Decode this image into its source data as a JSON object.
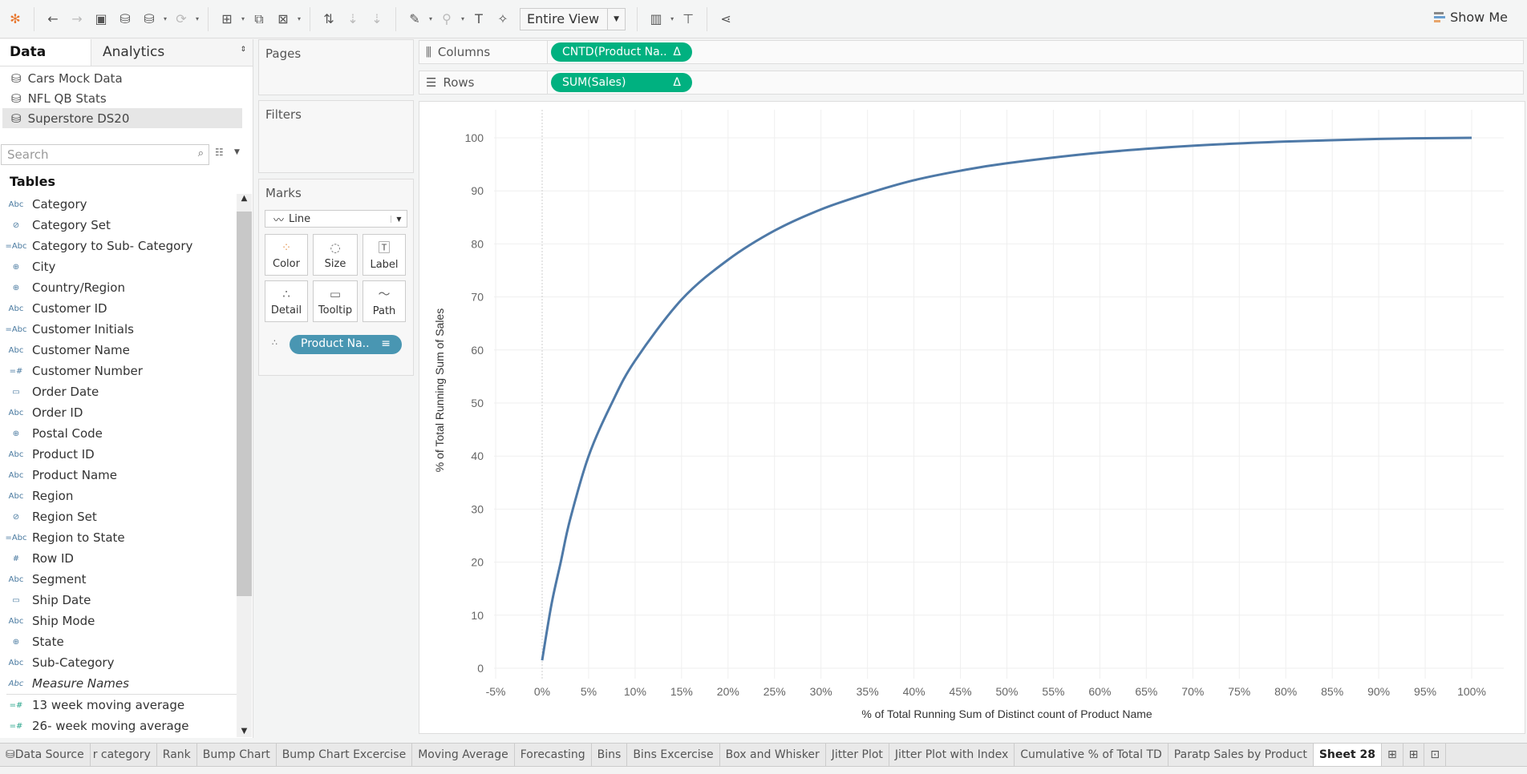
{
  "toolbar": {
    "fit": "Entire View",
    "show_me": "Show Me"
  },
  "left": {
    "tab_data": "Data",
    "tab_analytics": "Analytics",
    "datasources": [
      "Cars Mock Data",
      "NFL QB Stats",
      "Superstore DS20"
    ],
    "search_placeholder": "Search",
    "tables_heading": "Tables",
    "dims": [
      {
        "icon": "Abc",
        "label": "Category"
      },
      {
        "icon": "set",
        "label": "Category Set"
      },
      {
        "icon": "=Abc",
        "label": "Category to Sub- Category"
      },
      {
        "icon": "globe",
        "label": "City"
      },
      {
        "icon": "globe",
        "label": "Country/Region"
      },
      {
        "icon": "Abc",
        "label": "Customer ID"
      },
      {
        "icon": "=Abc",
        "label": "Customer Initials"
      },
      {
        "icon": "Abc",
        "label": "Customer Name"
      },
      {
        "icon": "=#",
        "label": "Customer Number"
      },
      {
        "icon": "date",
        "label": "Order Date"
      },
      {
        "icon": "Abc",
        "label": "Order ID"
      },
      {
        "icon": "globe",
        "label": "Postal Code"
      },
      {
        "icon": "Abc",
        "label": "Product ID"
      },
      {
        "icon": "Abc",
        "label": "Product Name"
      },
      {
        "icon": "Abc",
        "label": "Region"
      },
      {
        "icon": "set",
        "label": "Region Set"
      },
      {
        "icon": "=Abc",
        "label": "Region to State"
      },
      {
        "icon": "#",
        "label": "Row ID"
      },
      {
        "icon": "Abc",
        "label": "Segment"
      },
      {
        "icon": "date",
        "label": "Ship Date"
      },
      {
        "icon": "Abc",
        "label": "Ship Mode"
      },
      {
        "icon": "globe",
        "label": "State"
      },
      {
        "icon": "Abc",
        "label": "Sub-Category"
      },
      {
        "icon": "Abc",
        "label": "Measure Names"
      }
    ],
    "measures": [
      {
        "icon": "=#",
        "label": "13 week moving average"
      },
      {
        "icon": "=#",
        "label": "26- week moving average"
      }
    ]
  },
  "cards": {
    "pages": "Pages",
    "filters": "Filters",
    "marks": "Marks",
    "mark_type": "Line",
    "buttons": [
      "Color",
      "Size",
      "Label",
      "Detail",
      "Tooltip",
      "Path"
    ],
    "detail_pill": "Product Na.."
  },
  "shelves": {
    "columns_label": "Columns",
    "columns_pill": "CNTD(Product Na..",
    "rows_label": "Rows",
    "rows_pill": "SUM(Sales)",
    "delta": "Δ"
  },
  "chart_data": {
    "type": "line",
    "xlabel": "% of Total Running Sum of Distinct count of Product Name",
    "ylabel": "% of Total Running Sum of Sales",
    "xlim": [
      -5,
      100
    ],
    "ylim": [
      0,
      100
    ],
    "x_ticks": [
      -5,
      0,
      5,
      10,
      15,
      20,
      25,
      30,
      35,
      40,
      45,
      50,
      55,
      60,
      65,
      70,
      75,
      80,
      85,
      90,
      95,
      100
    ],
    "y_ticks": [
      0,
      10,
      20,
      30,
      40,
      50,
      60,
      70,
      80,
      90,
      100
    ],
    "grid": true,
    "color": "#4e79a7",
    "x": [
      0,
      1,
      2,
      3,
      5,
      7.5,
      10,
      15,
      20,
      25,
      30,
      35,
      40,
      45,
      50,
      60,
      70,
      80,
      90,
      100
    ],
    "y": [
      1.5,
      12,
      20,
      28,
      40,
      50,
      58,
      69.5,
      77,
      82.5,
      86.5,
      89.5,
      92,
      93.8,
      95.2,
      97.2,
      98.5,
      99.3,
      99.8,
      100
    ]
  },
  "sheet_tabs": [
    "Data Source",
    "r category",
    "Rank",
    "Bump Chart",
    "Bump Chart Excercise",
    "Moving Average",
    "Forecasting",
    "Bins",
    "Bins Excercise",
    "Box and Whisker",
    "Jitter Plot",
    "Jitter Plot with Index",
    "Cumulative % of Total TD",
    "Paratp Sales by Product",
    "Sheet 28"
  ]
}
